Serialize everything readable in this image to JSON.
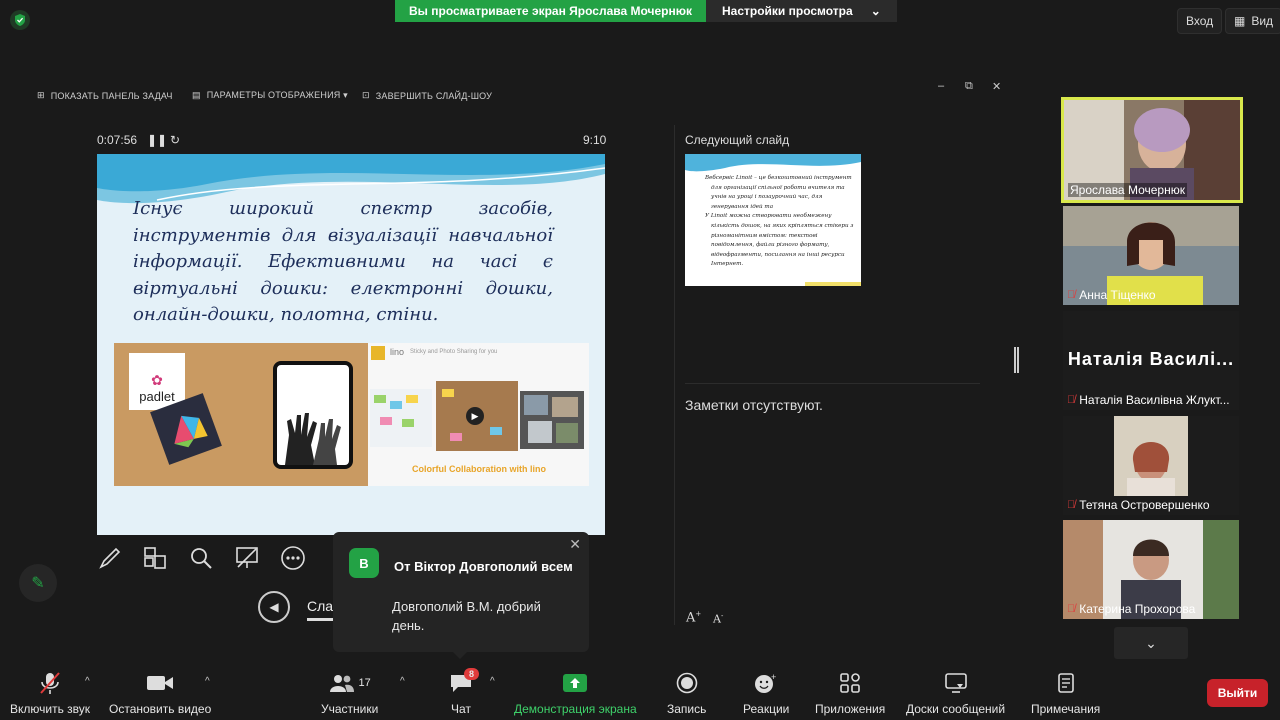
{
  "banner": {
    "sharing_text": "Вы просматриваете экран Ярослава Мочернюк",
    "view_options": "Настройки просмотра"
  },
  "top_right": {
    "enter": "Вход",
    "view": "Вид"
  },
  "presenter_toolbar": {
    "show_taskbar": "ПОКАЗАТЬ ПАНЕЛЬ ЗАДАЧ",
    "display_settings": "ПАРАМЕТРЫ ОТОБРАЖЕНИЯ ▾",
    "end_slideshow": "ЗАВЕРШИТЬ СЛАЙД-ШОУ"
  },
  "timer": {
    "elapsed": "0:07:56",
    "clock": "9:10"
  },
  "slide": {
    "lines": [
      "Існує широкий спектр засобів,",
      "інструментів для візуалізації навчальної",
      "інформації. Ефективними на часі є",
      "віртуальні дошки: електронні дошки,",
      "онлайн-дошки, полотна, стіни."
    ],
    "padlet": "padlet",
    "lino_logo": "lino",
    "lino_tagline": "Sticky and Photo Sharing for you",
    "lino_caption": "Colorful Collaboration with lino"
  },
  "next_slide": {
    "heading": "Следующий слайд",
    "text1": "Вебсервіс Linoit – це безкоштовний інструмент для організації спільної роботи вчителя та учнів на уроці і позаурочний час, для генерування ідей та",
    "text2": "У Linoit можна створювати необмежену кількість дошок, на яких кріпляться стікери з різноманітним вмістом: текстові повідомлення, файли різного формату, відеофрагменти, посилання на інші ресурси Інтернет."
  },
  "notes": {
    "empty": "Заметки отсутствуют."
  },
  "slide_nav": {
    "label": "Слайд"
  },
  "chat_popup": {
    "avatar_letter": "В",
    "sender": "От Віктор Довгополий всем",
    "message": "Довгополий В.М. добрий день."
  },
  "participants_tiles": [
    {
      "name": "Ярослава Мочернюк",
      "muted": false
    },
    {
      "name": "Анна Тіщенко",
      "muted": true
    },
    {
      "name": "Наталія Василівна Жлукт...",
      "muted": true,
      "big_name": "Наталія Василі..."
    },
    {
      "name": "Тетяна Островершенко",
      "muted": true
    },
    {
      "name": "Катерина Прохорова",
      "muted": true
    }
  ],
  "bottom_bar": {
    "unmute": "Включить звук",
    "start_video": "Остановить видео",
    "participants": "Участники",
    "participants_count": "17",
    "chat": "Чат",
    "chat_badge": "8",
    "share": "Демонстрация экрана",
    "record": "Запись",
    "reactions": "Реакции",
    "apps": "Приложения",
    "whiteboards": "Доски сообщений",
    "notes": "Примечания",
    "leave": "Выйти"
  },
  "colors": {
    "zoom_green": "#23a245",
    "leave_red": "#c7222a",
    "speaker_border": "#d9e84c"
  }
}
